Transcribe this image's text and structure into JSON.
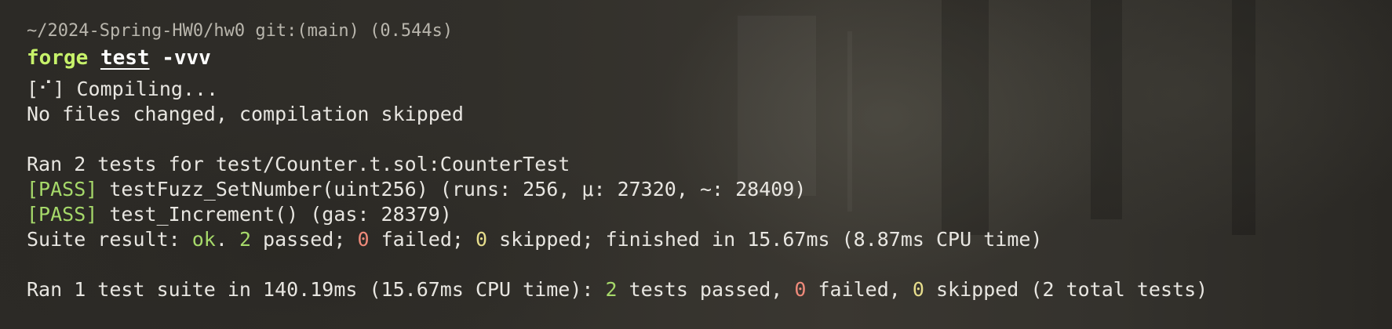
{
  "terminal": {
    "prompt": {
      "path": "~/2024-Spring-HW0/hw0",
      "git": "git:(main)",
      "duration": "(0.544s)"
    },
    "command": {
      "program": "forge",
      "subcommand": "test",
      "flag": "-vvv"
    },
    "compile": {
      "spinner": "[⠊]",
      "status": "Compiling...",
      "message": "No files changed, compilation skipped"
    },
    "run": {
      "header": "Ran 2 tests for test/Counter.t.sol:CounterTest",
      "tests": [
        {
          "status": "[PASS]",
          "detail": "testFuzz_SetNumber(uint256) (runs: 256, μ: 27320, ~: 28409)"
        },
        {
          "status": "[PASS]",
          "detail": "test_Increment() (gas: 28379)"
        }
      ],
      "suite": {
        "prefix": "Suite result: ",
        "ok": "ok",
        "dot": ". ",
        "passed_count": "2",
        "passed_label": " passed; ",
        "failed_count": "0",
        "failed_label": " failed; ",
        "skipped_count": "0",
        "skipped_label": " skipped; finished in 15.67ms (8.87ms CPU time)"
      }
    },
    "summary": {
      "prefix": "Ran 1 test suite in 140.19ms (15.67ms CPU time): ",
      "passed_count": "2",
      "passed_label": " tests passed, ",
      "failed_count": "0",
      "failed_label": " failed, ",
      "skipped_count": "0",
      "skipped_label": " skipped (2 total tests)"
    }
  },
  "colors": {
    "command_green": "#c7f26a",
    "pass_green": "#a6d96a",
    "fail_red": "#ef8a7a",
    "skip_yellow": "#e6dd8c",
    "text": "#e8e6e1"
  }
}
